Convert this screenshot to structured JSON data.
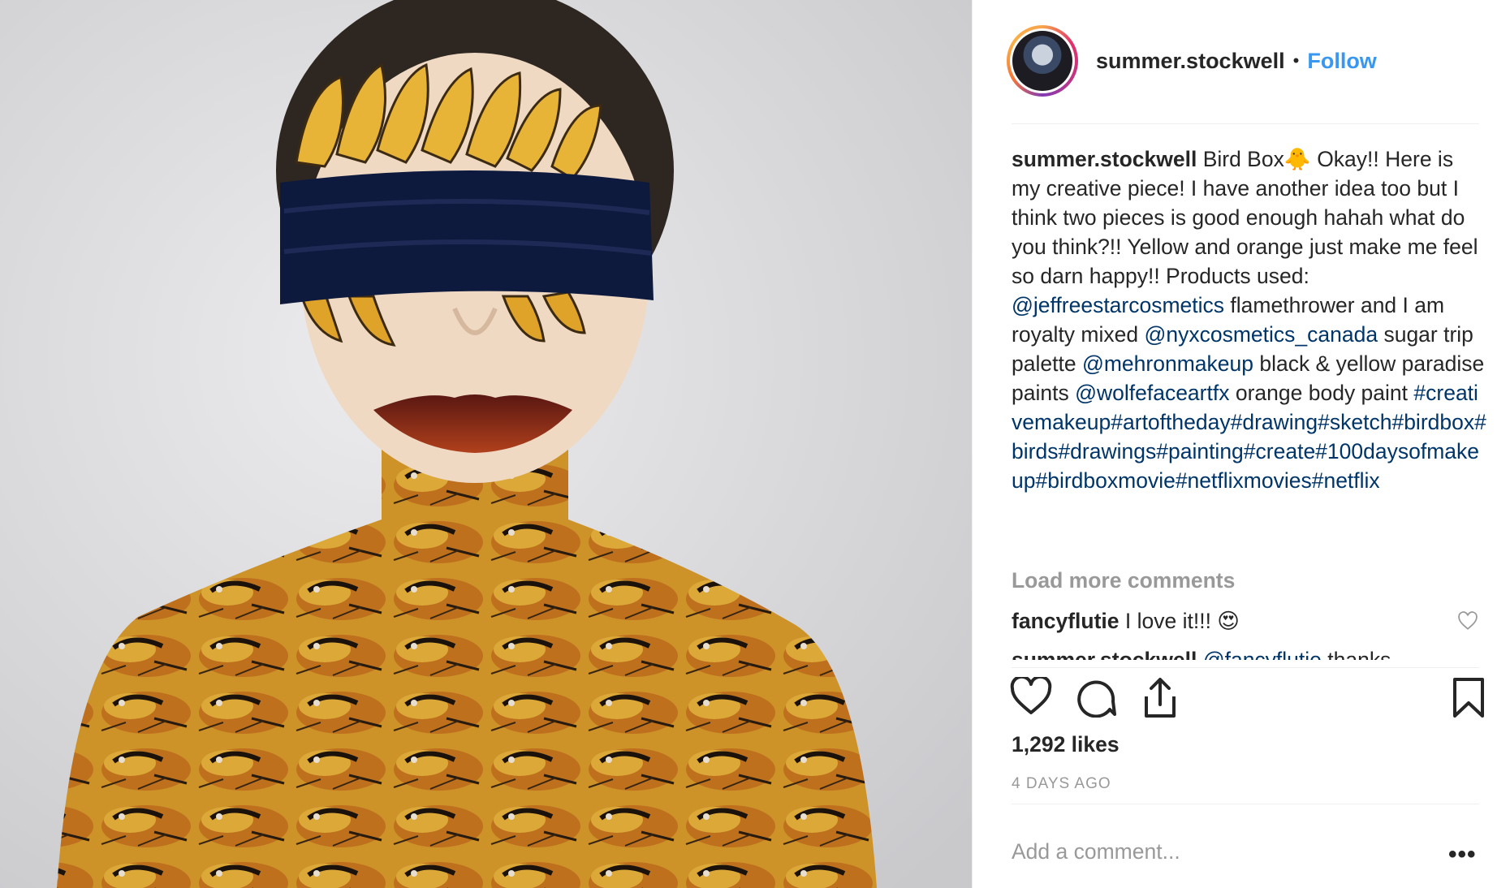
{
  "post": {
    "username": "summer.stockwell",
    "separator": "•",
    "follow_label": "Follow",
    "image_icon": "photo-of-blindfolded-woman-with-bird-body-paint"
  },
  "caption": {
    "username": "summer.stockwell",
    "text_1": "Bird Box🐥  Okay!! Here is my creative piece! I have another idea too but I think two pieces is good enough hahah what do you think?!! Yellow and orange just make me feel so darn happy!! Products used: ",
    "mention_1": "@jeffreestarcosmetics",
    "text_2": " flamethrower and I am royalty mixed ",
    "mention_2": "@nyxcosmetics_canada",
    "text_3": " sugar trip palette ",
    "mention_3": "@mehronmakeup",
    "text_4": " black & yellow paradise paints ",
    "mention_4": "@wolfefaceartfx",
    "text_5": " orange body paint ",
    "hashtags": "#creativemakeup#artoftheday#drawing#sketch#birdbox#birds#drawings#painting#create#100daysofmakeup#birdboxmovie#netflixmovies#netflix"
  },
  "comments": {
    "load_more": "Load more comments",
    "items": [
      {
        "username": "fancyflutie",
        "text": "I love it!!! 😍"
      },
      {
        "username": "summer.stockwell",
        "mention": "@fancyflutie",
        "text": " thanks"
      }
    ]
  },
  "actions": {
    "like_icon": "heart-outline-icon",
    "comment_icon": "speech-bubble-icon",
    "share_icon": "share-upload-icon",
    "save_icon": "bookmark-icon"
  },
  "likes": "1,292 likes",
  "timestamp": "4 DAYS AGO",
  "comment_box": {
    "placeholder": "Add a comment...",
    "more_label": "•••"
  },
  "colors": {
    "link_blue": "#3897f0",
    "mention_navy": "#003569",
    "muted_gray": "#999999",
    "text": "#262626"
  }
}
